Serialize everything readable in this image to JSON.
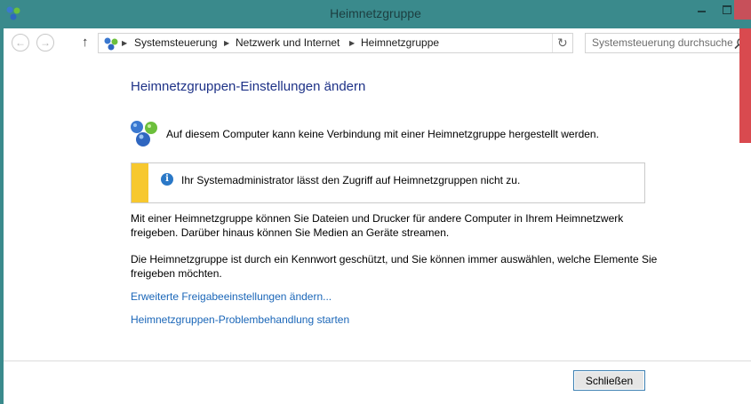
{
  "window": {
    "title": "Heimnetzgruppe"
  },
  "address": {
    "crumbs": [
      "Systemsteuerung",
      "Netzwerk und Internet",
      "Heimnetzgruppe"
    ]
  },
  "search": {
    "placeholder": "Systemsteuerung durchsuchen"
  },
  "content": {
    "heading": "Heimnetzgruppen-Einstellungen ändern",
    "status": "Auf diesem Computer kann keine Verbindung mit einer Heimnetzgruppe hergestellt werden.",
    "info": "Ihr Systemadministrator lässt den Zugriff auf Heimnetzgruppen nicht zu.",
    "paragraph1": "Mit einer Heimnetzgruppe können Sie Dateien und Drucker für andere Computer in Ihrem Heimnetzwerk freigeben. Darüber hinaus können Sie Medien an Geräte streamen.",
    "paragraph2": "Die Heimnetzgruppe ist durch ein Kennwort geschützt, und Sie können immer auswählen, welche Elemente Sie freigeben möchten.",
    "link1": "Erweiterte Freigabeeinstellungen ändern...",
    "link2": "Heimnetzgruppen-Problembehandlung starten"
  },
  "footer": {
    "close_label": "Schließen"
  },
  "colors": {
    "titlebar": "#3a8a8c",
    "heading": "#1e3287",
    "link": "#1a66b8",
    "warning_stripe": "#f7c82f"
  },
  "icons": {
    "app": "homegroup-icon",
    "back": "back-arrow-icon",
    "forward": "forward-arrow-icon",
    "up": "up-arrow-icon",
    "refresh": "refresh-icon",
    "search": "search-icon",
    "info": "info-icon"
  }
}
